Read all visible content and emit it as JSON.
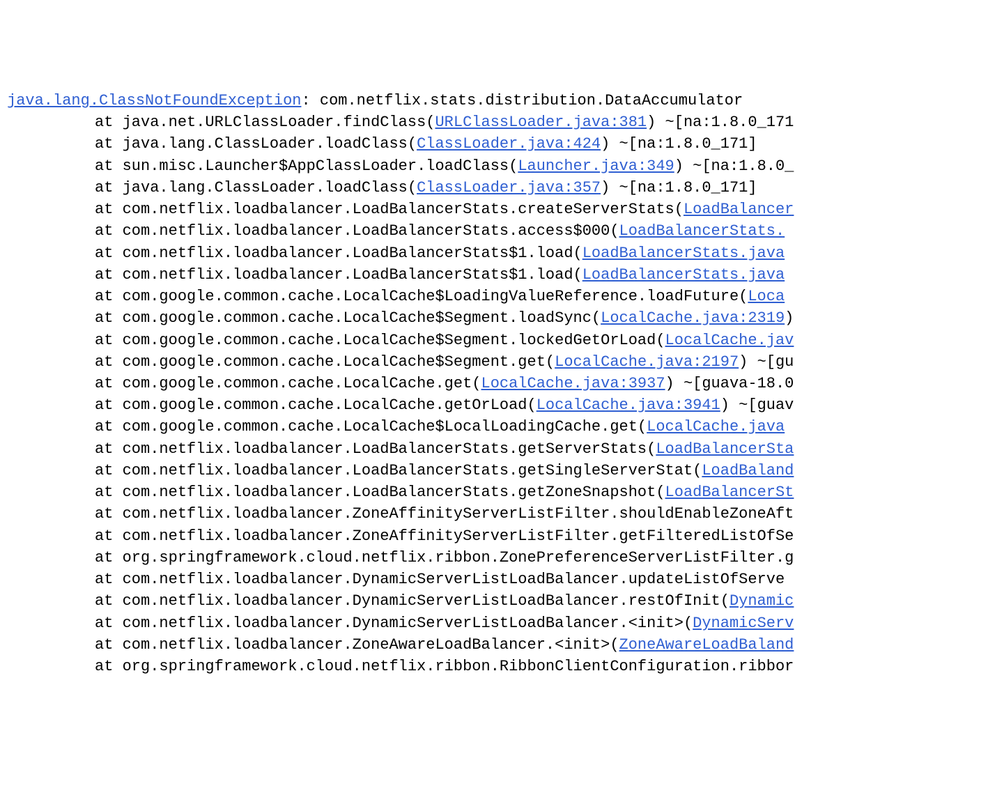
{
  "exception": {
    "class": "java.lang.ClassNotFoundException",
    "message": "com.netflix.stats.distribution.DataAccumulator"
  },
  "lines": [
    {
      "at": "at",
      "pre": "java.net.URLClassLoader.findClass(",
      "link": "URLClassLoader.java:381",
      "post": ") ~[na:1.8.0_171"
    },
    {
      "at": "at",
      "pre": "java.lang.ClassLoader.loadClass(",
      "link": "ClassLoader.java:424",
      "post": ") ~[na:1.8.0_171]"
    },
    {
      "at": "at",
      "pre": "sun.misc.Launcher$AppClassLoader.loadClass(",
      "link": "Launcher.java:349",
      "post": ") ~[na:1.8.0_"
    },
    {
      "at": "at",
      "pre": "java.lang.ClassLoader.loadClass(",
      "link": "ClassLoader.java:357",
      "post": ") ~[na:1.8.0_171]"
    },
    {
      "at": "at",
      "pre": "com.netflix.loadbalancer.LoadBalancerStats.createServerStats(",
      "link": "LoadBalancer",
      "post": ""
    },
    {
      "at": "at",
      "pre": "com.netflix.loadbalancer.LoadBalancerStats.access$000(",
      "link": "LoadBalancerStats.",
      "post": ""
    },
    {
      "at": "at",
      "pre": "com.netflix.loadbalancer.LoadBalancerStats$1.load(",
      "link": "LoadBalancerStats.java",
      "post": ""
    },
    {
      "at": "at",
      "pre": "com.netflix.loadbalancer.LoadBalancerStats$1.load(",
      "link": "LoadBalancerStats.java",
      "post": ""
    },
    {
      "at": "at",
      "pre": "com.google.common.cache.LocalCache$LoadingValueReference.loadFuture(",
      "link": "Loca",
      "post": ""
    },
    {
      "at": "at",
      "pre": "com.google.common.cache.LocalCache$Segment.loadSync(",
      "link": "LocalCache.java:2319",
      "post": ")"
    },
    {
      "at": "at",
      "pre": "com.google.common.cache.LocalCache$Segment.lockedGetOrLoad(",
      "link": "LocalCache.jav",
      "post": ""
    },
    {
      "at": "at",
      "pre": "com.google.common.cache.LocalCache$Segment.get(",
      "link": "LocalCache.java:2197",
      "post": ") ~[gu"
    },
    {
      "at": "at",
      "pre": "com.google.common.cache.LocalCache.get(",
      "link": "LocalCache.java:3937",
      "post": ") ~[guava-18.0"
    },
    {
      "at": "at",
      "pre": "com.google.common.cache.LocalCache.getOrLoad(",
      "link": "LocalCache.java:3941",
      "post": ") ~[guav"
    },
    {
      "at": "at",
      "pre": "com.google.common.cache.LocalCache$LocalLoadingCache.get(",
      "link": "LocalCache.java",
      "post": ""
    },
    {
      "at": "at",
      "pre": "com.netflix.loadbalancer.LoadBalancerStats.getServerStats(",
      "link": "LoadBalancerSta",
      "post": ""
    },
    {
      "at": "at",
      "pre": "com.netflix.loadbalancer.LoadBalancerStats.getSingleServerStat(",
      "link": "LoadBaland",
      "post": ""
    },
    {
      "at": "at",
      "pre": "com.netflix.loadbalancer.LoadBalancerStats.getZoneSnapshot(",
      "link": "LoadBalancerSt",
      "post": ""
    },
    {
      "at": "at",
      "pre": "com.netflix.loadbalancer.ZoneAffinityServerListFilter.shouldEnableZoneAft",
      "link": "",
      "post": ""
    },
    {
      "at": "at",
      "pre": "com.netflix.loadbalancer.ZoneAffinityServerListFilter.getFilteredListOfSe",
      "link": "",
      "post": ""
    },
    {
      "at": "at",
      "pre": "org.springframework.cloud.netflix.ribbon.ZonePreferenceServerListFilter.g",
      "link": "",
      "post": ""
    },
    {
      "at": "at",
      "pre": "com.netflix.loadbalancer.DynamicServerListLoadBalancer.updateListOfServe",
      "link": "",
      "post": ""
    },
    {
      "at": "at",
      "pre": "com.netflix.loadbalancer.DynamicServerListLoadBalancer.restOfInit(",
      "link": "Dynamic",
      "post": ""
    },
    {
      "at": "at",
      "pre": "com.netflix.loadbalancer.DynamicServerListLoadBalancer.<init>(",
      "link": "DynamicServ",
      "post": ""
    },
    {
      "at": "at",
      "pre": "com.netflix.loadbalancer.ZoneAwareLoadBalancer.<init>(",
      "link": "ZoneAwareLoadBaland",
      "post": ""
    },
    {
      "at": "at",
      "pre": "org.springframework.cloud.netflix.ribbon.RibbonClientConfiguration.ribbor",
      "link": "",
      "post": ""
    }
  ]
}
